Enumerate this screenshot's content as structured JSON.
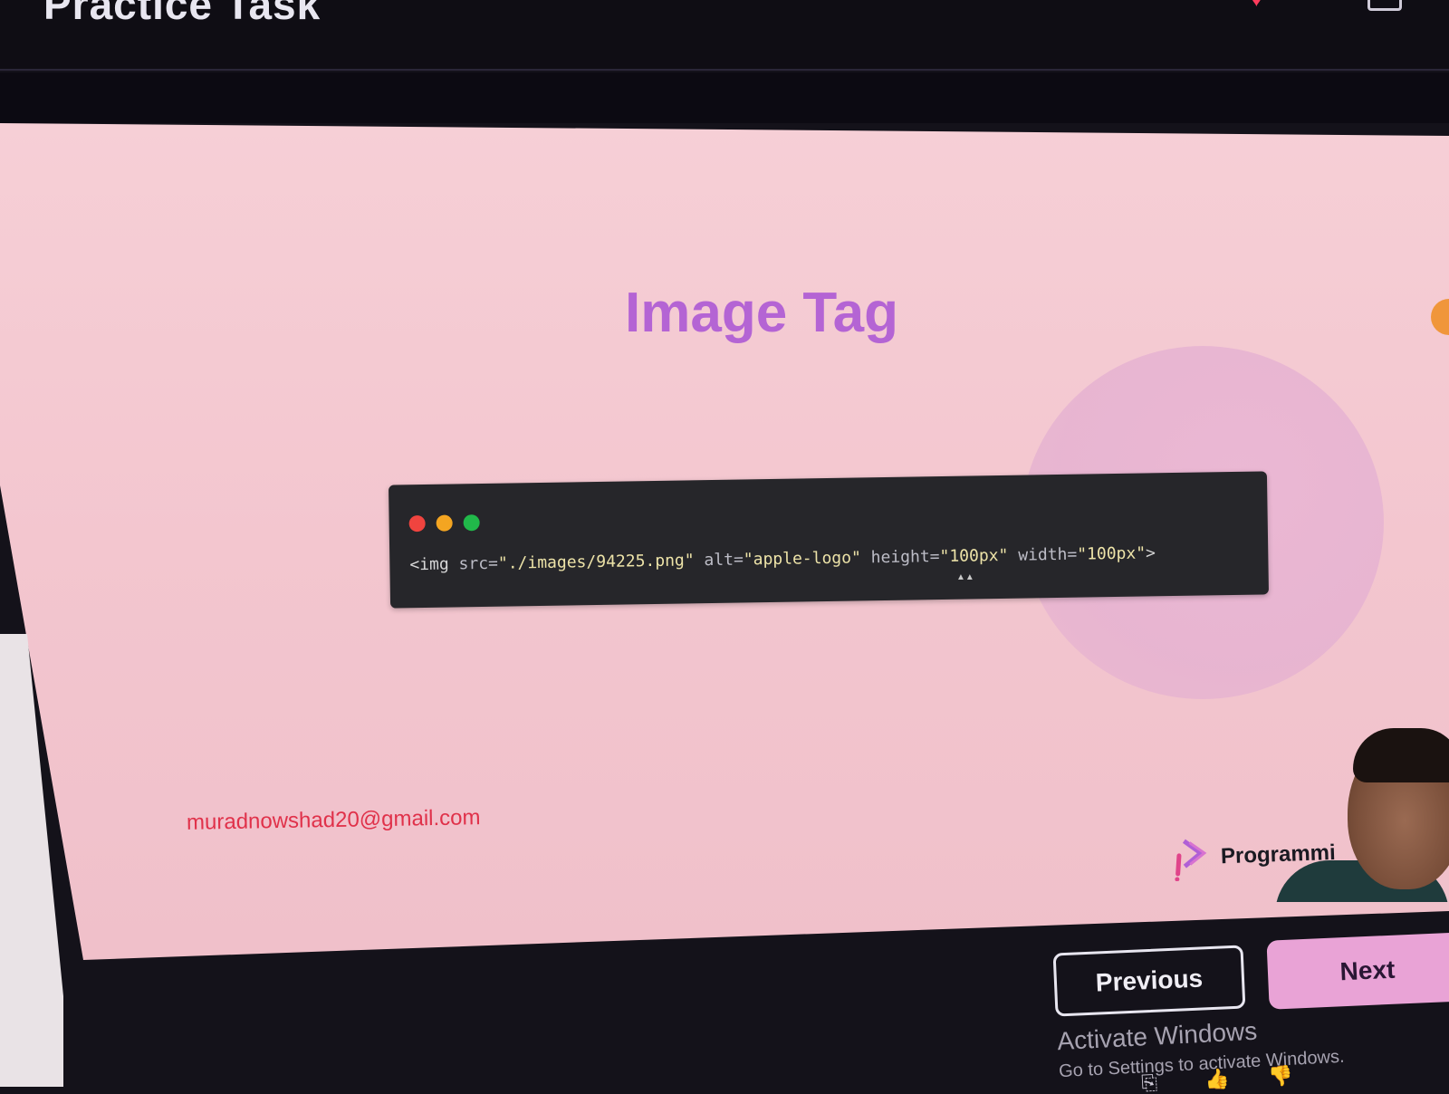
{
  "app": {
    "title": "Practice Task"
  },
  "slide": {
    "title": "Image Tag",
    "code": {
      "tag_open": "<img ",
      "src_attr": "src=",
      "src_value": "\"./images/94225.png\"",
      "alt_attr": " alt=",
      "alt_value": "\"apple-logo\"",
      "height_attr": " height=",
      "height_value": "\"100px\"",
      "width_attr": " width=",
      "width_value": "\"100px\"",
      "tag_close": ">"
    },
    "email": "muradnowshad20@gmail.com",
    "brand": "Programmi"
  },
  "navigation": {
    "previous_label": "Previous",
    "next_label": "Next"
  },
  "watermark": {
    "title": "Activate Windows",
    "subtitle": "Go to Settings to activate Windows."
  },
  "colors": {
    "slide_bg": "#f3c6cf",
    "title": "#b464d4",
    "email": "#e0314a",
    "next_button": "#e9a3d6",
    "code_bg": "#26262a"
  },
  "icons": [
    "heart-icon",
    "window-icon",
    "brand-logo-icon",
    "like-icon",
    "dislike-icon",
    "share-icon"
  ]
}
